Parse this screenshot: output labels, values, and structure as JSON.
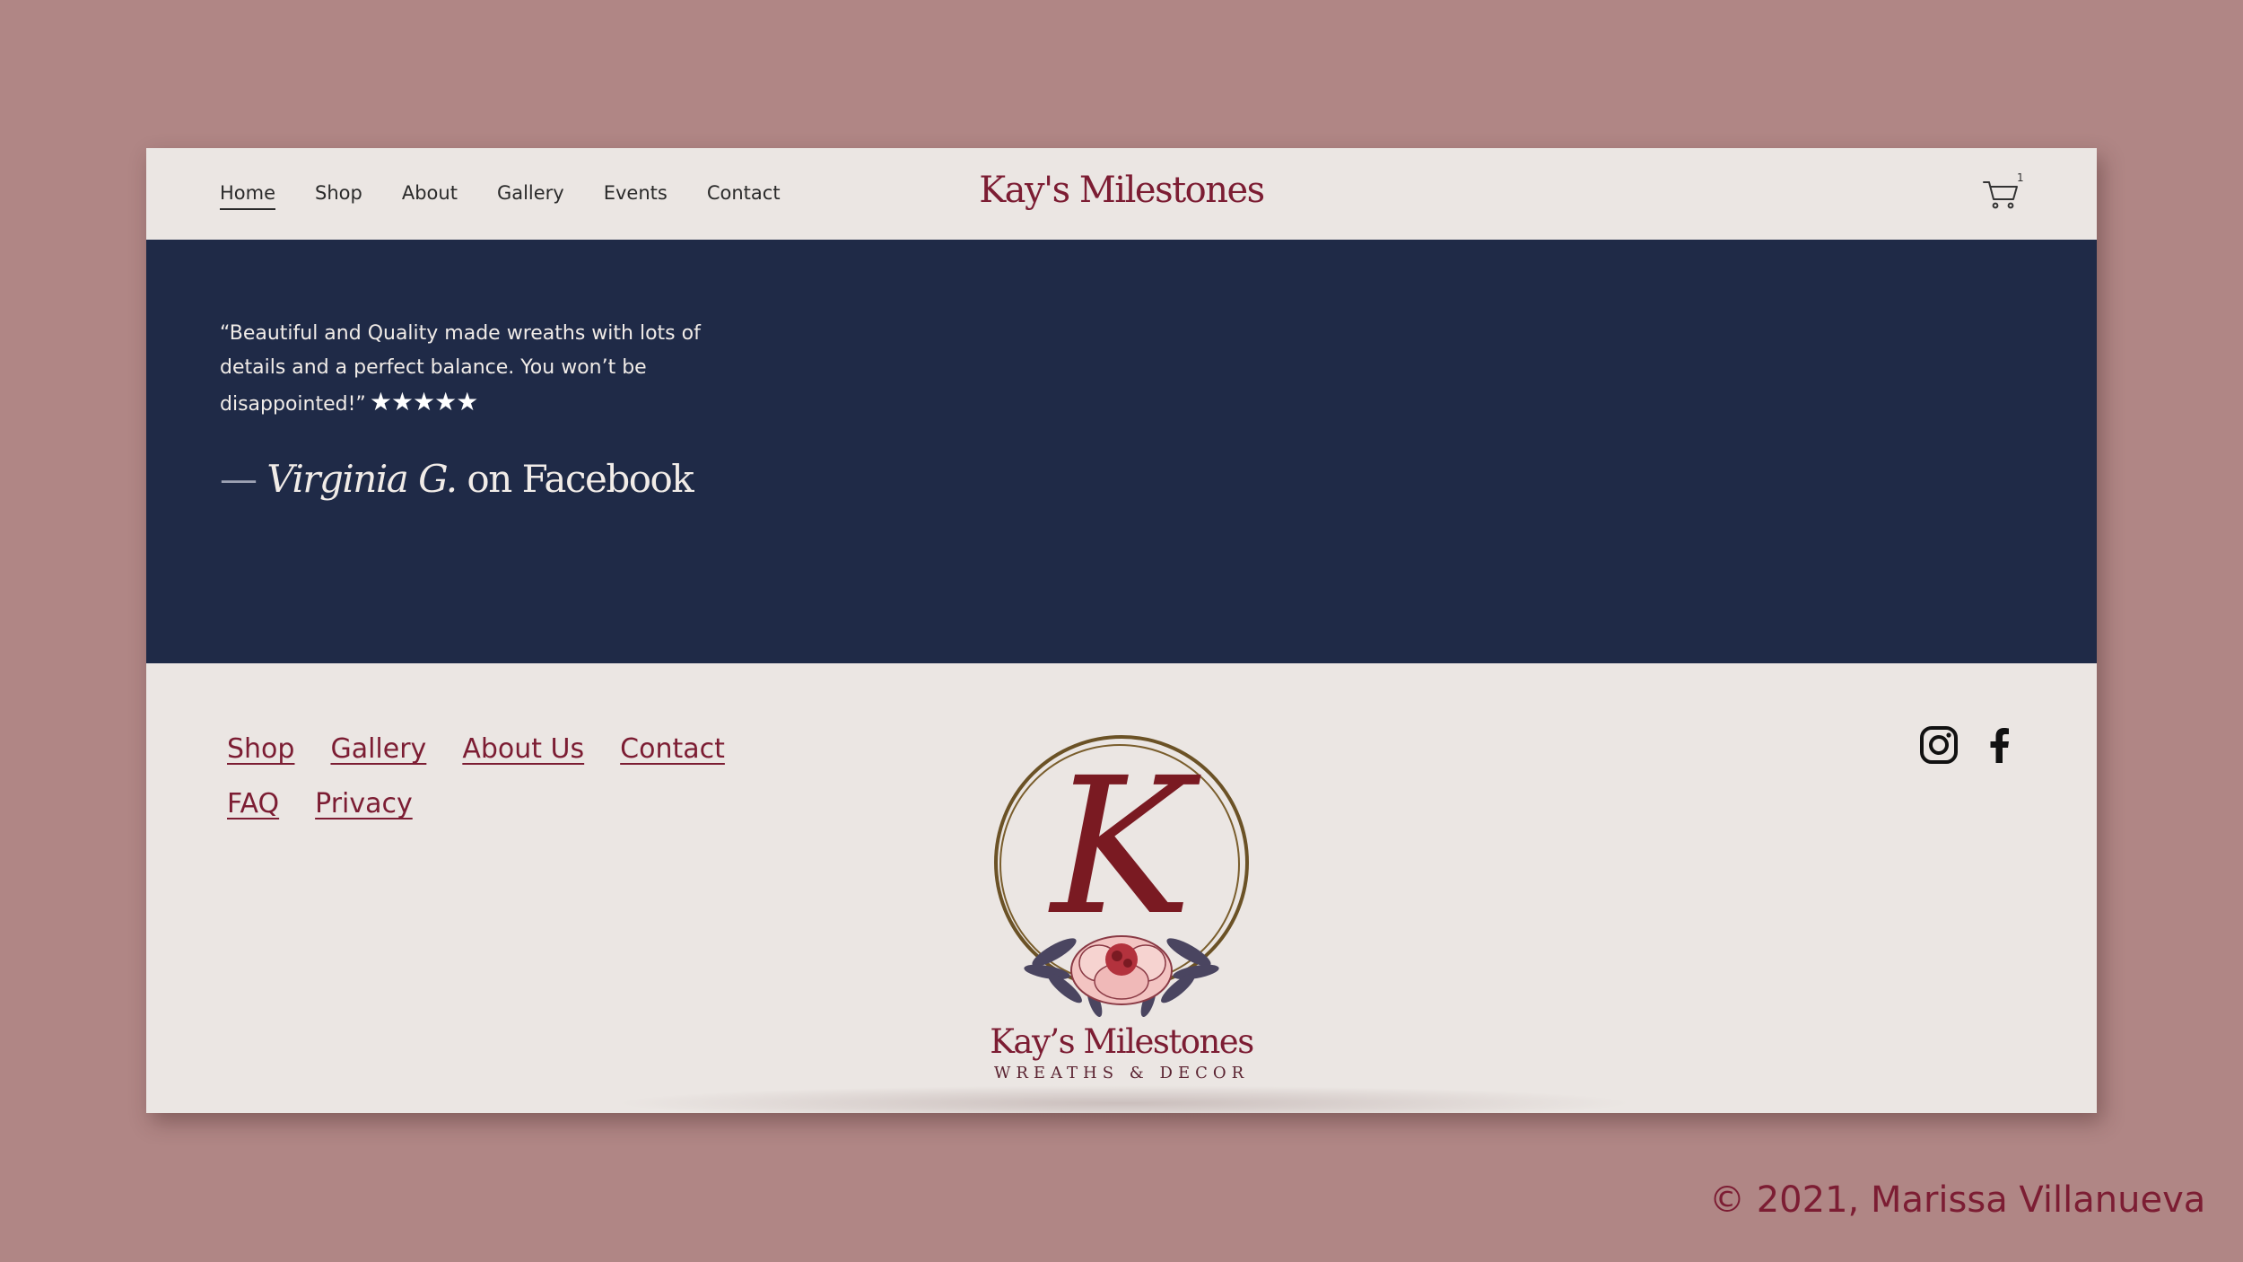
{
  "header": {
    "nav": [
      {
        "label": "Home",
        "active": true
      },
      {
        "label": "Shop"
      },
      {
        "label": "About"
      },
      {
        "label": "Gallery"
      },
      {
        "label": "Events"
      },
      {
        "label": "Contact"
      }
    ],
    "brand": "Kay's Milestones",
    "cart": {
      "icon": "cart-icon",
      "count": "1"
    }
  },
  "testimonial": {
    "quote": "“Beautiful and Quality made wreaths with lots of details and a perfect balance. You won’t be disappointed!”",
    "stars": "★★★★★",
    "rating": 5,
    "dash": "—",
    "author": "Virginia G.",
    "source": "on Facebook"
  },
  "footer": {
    "links_row1": [
      "Shop",
      "Gallery",
      "About Us",
      "Contact"
    ],
    "links_row2": [
      "FAQ",
      "Privacy"
    ],
    "logo": {
      "monogram": "K",
      "name": "Kay’s Milestones",
      "tagline": "WREATHS & DECOR"
    },
    "social": [
      {
        "name": "instagram-icon"
      },
      {
        "name": "facebook-icon"
      }
    ]
  },
  "copyright": "© 2021, Marissa Villanueva",
  "colors": {
    "background": "#b08685",
    "page": "#ebe6e3",
    "navy": "#1f2a47",
    "accent": "#7c1d33"
  }
}
